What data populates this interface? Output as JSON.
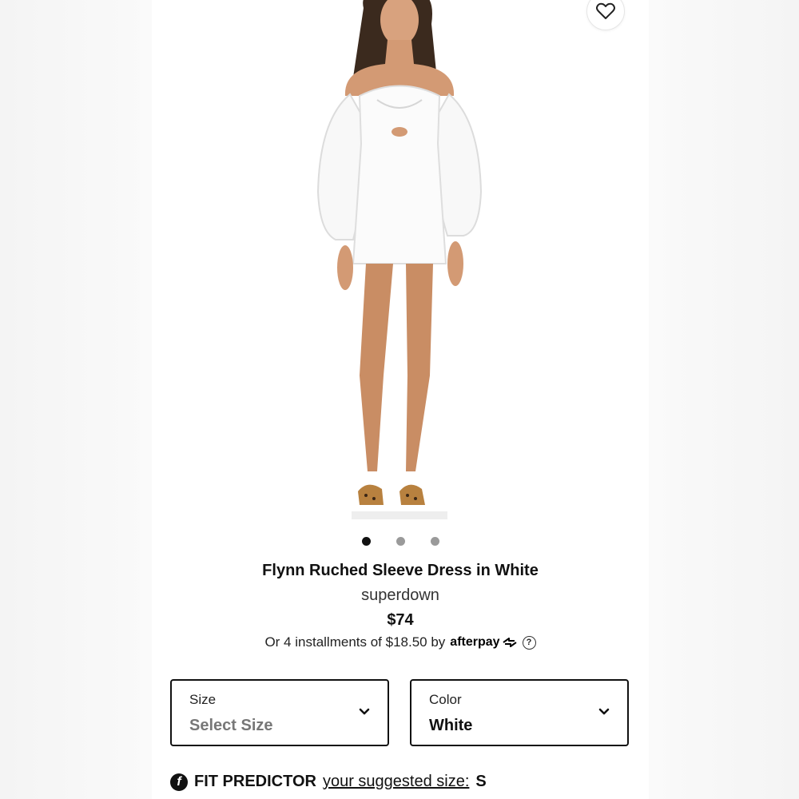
{
  "product": {
    "title": "Flynn Ruched Sleeve Dress in White",
    "brand": "superdown",
    "price": "$74",
    "installments_text": "Or 4 installments of $18.50 by",
    "afterpay_label": "afterpay",
    "help_glyph": "?"
  },
  "gallery": {
    "dots": 3,
    "active_index": 0,
    "image_icon": "product-photo"
  },
  "options": {
    "size": {
      "label": "Size",
      "value": "Select Size"
    },
    "color": {
      "label": "Color",
      "value": "White"
    }
  },
  "fit_predictor": {
    "icon_glyph": "f",
    "title": "FIT PREDICTOR",
    "link_text": "your suggested size:",
    "suggested_size": "S"
  },
  "colors": {
    "accent": "#111111",
    "muted_dot": "#9a9a9a"
  }
}
